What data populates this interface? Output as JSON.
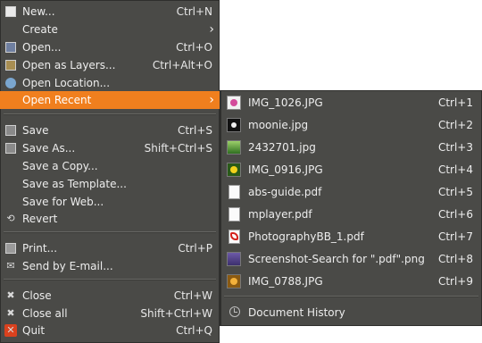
{
  "main_menu": {
    "items": [
      {
        "label": "New...",
        "accel": "Ctrl+N",
        "icon": "new-icon"
      },
      {
        "label": "Create",
        "accel": "",
        "icon": "",
        "submenu": true
      },
      {
        "label": "Open...",
        "accel": "Ctrl+O",
        "icon": "open-icon"
      },
      {
        "label": "Open as Layers...",
        "accel": "Ctrl+Alt+O",
        "icon": "open-layers-icon"
      },
      {
        "label": "Open Location...",
        "accel": "",
        "icon": "open-location-icon"
      },
      {
        "label": "Open Recent",
        "accel": "",
        "icon": "",
        "submenu": true,
        "highlighted": true
      },
      {
        "label": "Save",
        "accel": "Ctrl+S",
        "icon": "save-icon"
      },
      {
        "label": "Save As...",
        "accel": "Shift+Ctrl+S",
        "icon": "save-as-icon"
      },
      {
        "label": "Save a Copy...",
        "accel": "",
        "icon": ""
      },
      {
        "label": "Save as Template...",
        "accel": "",
        "icon": ""
      },
      {
        "label": "Save for Web...",
        "accel": "",
        "icon": ""
      },
      {
        "label": "Revert",
        "accel": "",
        "icon": "revert-icon"
      },
      {
        "label": "Print...",
        "accel": "Ctrl+P",
        "icon": "print-icon"
      },
      {
        "label": "Send by E-mail...",
        "accel": "",
        "icon": "email-icon"
      },
      {
        "label": "Close",
        "accel": "Ctrl+W",
        "icon": "close-icon"
      },
      {
        "label": "Close all",
        "accel": "Shift+Ctrl+W",
        "icon": "close-all-icon"
      },
      {
        "label": "Quit",
        "accel": "Ctrl+Q",
        "icon": "quit-icon"
      }
    ]
  },
  "recent_menu": {
    "items": [
      {
        "label": "IMG_1026.JPG",
        "accel": "Ctrl+1",
        "icon": "image-thumbnail-icon"
      },
      {
        "label": "moonie.jpg",
        "accel": "Ctrl+2",
        "icon": "image-thumbnail-icon"
      },
      {
        "label": "2432701.jpg",
        "accel": "Ctrl+3",
        "icon": "image-thumbnail-icon"
      },
      {
        "label": "IMG_0916.JPG",
        "accel": "Ctrl+4",
        "icon": "image-thumbnail-icon"
      },
      {
        "label": "abs-guide.pdf",
        "accel": "Ctrl+5",
        "icon": "document-icon"
      },
      {
        "label": "mplayer.pdf",
        "accel": "Ctrl+6",
        "icon": "document-icon"
      },
      {
        "label": "PhotographyBB_1.pdf",
        "accel": "Ctrl+7",
        "icon": "pdf-icon"
      },
      {
        "label": "Screenshot-Search for \".pdf\".png",
        "accel": "Ctrl+8",
        "icon": "image-thumbnail-icon"
      },
      {
        "label": "IMG_0788.JPG",
        "accel": "Ctrl+9",
        "icon": "image-thumbnail-icon"
      }
    ],
    "history_label": "Document History"
  },
  "colors": {
    "menu_bg": "#4a4a47",
    "highlight": "#f07f1e",
    "text": "#ededed"
  },
  "glyphs": {
    "submenu_arrow": "›"
  }
}
